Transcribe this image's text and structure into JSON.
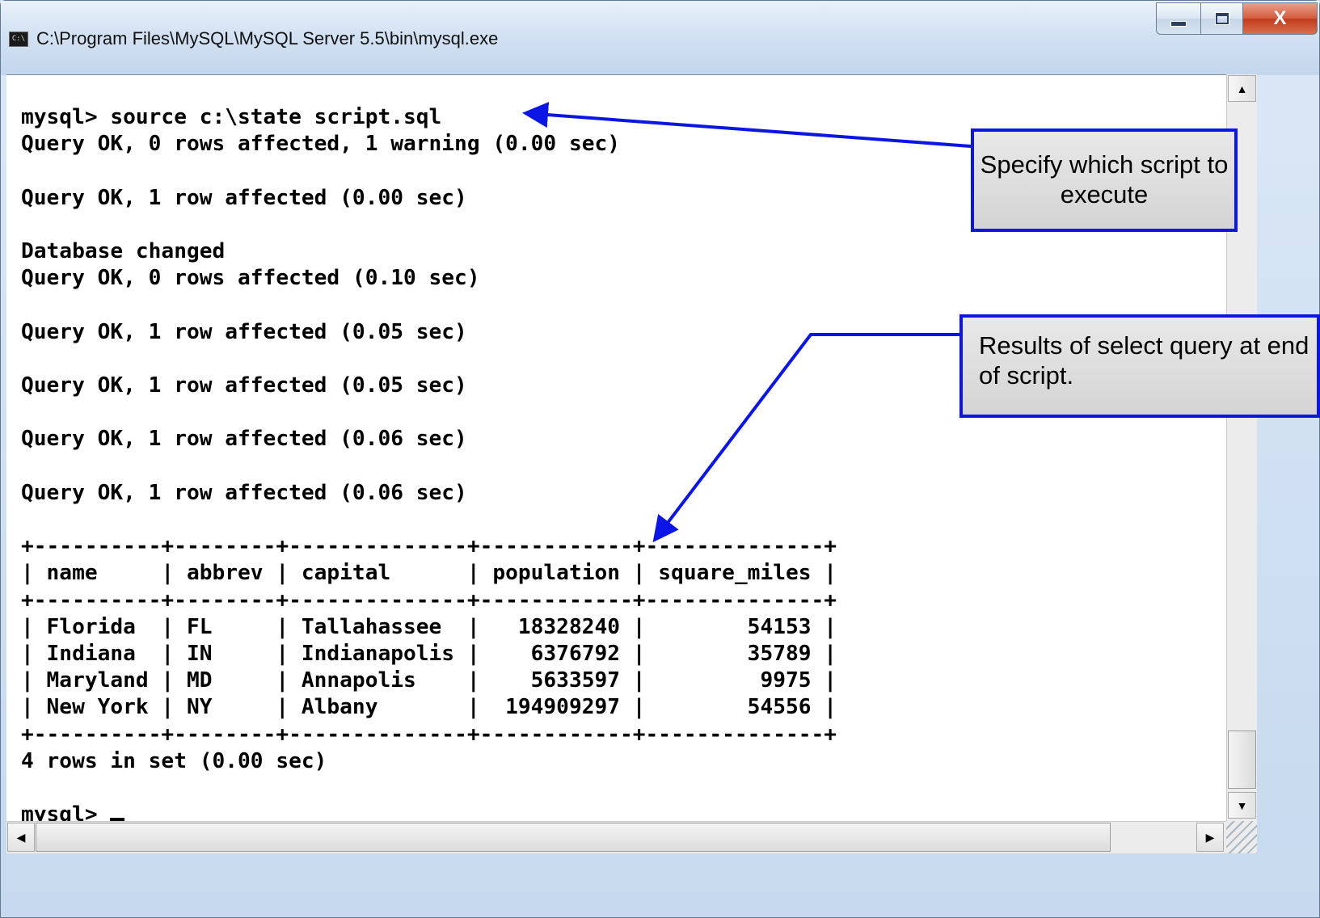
{
  "window": {
    "title": "C:\\Program Files\\MySQL\\MySQL Server 5.5\\bin\\mysql.exe",
    "app_icon_text": "C:\\",
    "buttons": {
      "minimize": "minimize-icon",
      "maximize": "maximize-icon",
      "close": "X"
    }
  },
  "console": {
    "lines": [
      "mysql> source c:\\state script.sql",
      "Query OK, 0 rows affected, 1 warning (0.00 sec)",
      "",
      "Query OK, 1 row affected (0.00 sec)",
      "",
      "Database changed",
      "Query OK, 0 rows affected (0.10 sec)",
      "",
      "Query OK, 1 row affected (0.05 sec)",
      "",
      "Query OK, 1 row affected (0.05 sec)",
      "",
      "Query OK, 1 row affected (0.06 sec)",
      "",
      "Query OK, 1 row affected (0.06 sec)",
      "",
      "+----------+--------+--------------+------------+--------------+",
      "| name     | abbrev | capital      | population | square_miles |",
      "+----------+--------+--------------+------------+--------------+",
      "| Florida  | FL     | Tallahassee  |   18328240 |        54153 |",
      "| Indiana  | IN     | Indianapolis |    6376792 |        35789 |",
      "| Maryland | MD     | Annapolis    |    5633597 |         9975 |",
      "| New York | NY     | Albany       |  194909297 |        54556 |",
      "+----------+--------+--------------+------------+--------------+",
      "4 rows in set (0.00 sec)",
      ""
    ],
    "prompt": "mysql> "
  },
  "callouts": {
    "script": "Specify which script to execute",
    "results": "Results of select query at end of script."
  },
  "scrollbar": {
    "up": "▲",
    "down": "▼",
    "left": "◀",
    "right": "▶"
  },
  "colors": {
    "callout_border": "#0b16e6",
    "arrow": "#0b16e6"
  }
}
